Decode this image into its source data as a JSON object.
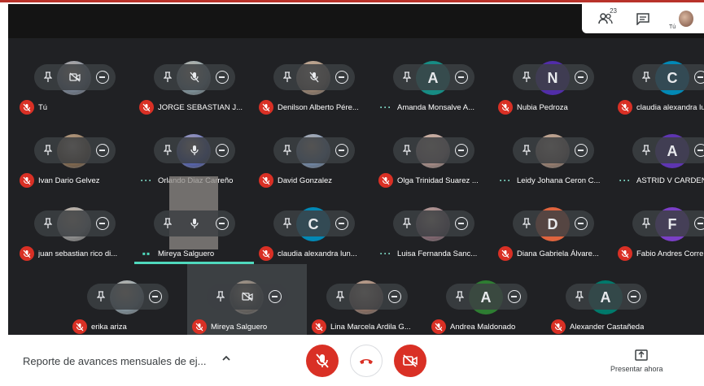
{
  "top_panel": {
    "people_count": "23",
    "you_label": "Tú"
  },
  "participants": [
    {
      "name": "Tú",
      "avatar_initial": "",
      "avatar_color": "#7f8b9d",
      "muted": true,
      "speaking": false,
      "center_icon": "camera-off-icon"
    },
    {
      "name": "JORGE SEBASTIAN J...",
      "avatar_initial": "",
      "avatar_color": "#8aa0a9",
      "muted": true,
      "speaking": false,
      "center_icon": "mic-off-icon"
    },
    {
      "name": "Denilson Alberto Pére...",
      "avatar_initial": "",
      "avatar_color": "#a58c78",
      "muted": true,
      "speaking": false,
      "center_icon": "mic-off-icon"
    },
    {
      "name": "Amanda Monsalve A...",
      "avatar_initial": "A",
      "avatar_color": "#178c84",
      "muted": false,
      "speaking": false,
      "center_icon": "avatar"
    },
    {
      "name": "Nubia Pedroza",
      "avatar_initial": "N",
      "avatar_color": "#512da8",
      "muted": true,
      "speaking": false,
      "center_icon": "avatar"
    },
    {
      "name": "claudia alexandra lu",
      "avatar_initial": "C",
      "avatar_color": "#0288b5",
      "muted": true,
      "speaking": false,
      "center_icon": "avatar"
    },
    {
      "name": "Ivan Dario Gelvez",
      "avatar_initial": "",
      "avatar_color": "#8b6f52",
      "muted": true,
      "speaking": false,
      "center_icon": "avatar"
    },
    {
      "name": "Orlando Diaz Carreño",
      "avatar_initial": "",
      "avatar_color": "#5c6bc0",
      "muted": false,
      "speaking": false,
      "center_icon": "mic-icon"
    },
    {
      "name": "David Gonzalez",
      "avatar_initial": "",
      "avatar_color": "#7a93b5",
      "muted": true,
      "speaking": false,
      "center_icon": "avatar"
    },
    {
      "name": "Olga Trinidad Suarez ...",
      "avatar_initial": "",
      "avatar_color": "#b89a94",
      "muted": true,
      "speaking": false,
      "center_icon": "avatar"
    },
    {
      "name": "Leidy Johana Ceron C...",
      "avatar_initial": "",
      "avatar_color": "#a78a79",
      "muted": false,
      "speaking": false,
      "center_icon": "avatar"
    },
    {
      "name": "ASTRID V CARDENA",
      "avatar_initial": "A",
      "avatar_color": "#5e35b1",
      "muted": false,
      "speaking": false,
      "center_icon": "avatar"
    },
    {
      "name": "juan sebastian rico di...",
      "avatar_initial": "",
      "avatar_color": "#9e9e9e",
      "muted": true,
      "speaking": false,
      "center_icon": "avatar"
    },
    {
      "name": "Mireya Salguero",
      "avatar_initial": "",
      "avatar_color": "#8e8a86",
      "muted": false,
      "speaking": true,
      "center_icon": "mic-icon"
    },
    {
      "name": "claudia alexandra lun...",
      "avatar_initial": "C",
      "avatar_color": "#0288b5",
      "muted": true,
      "speaking": false,
      "center_icon": "avatar"
    },
    {
      "name": "Luisa Fernanda Sanc...",
      "avatar_initial": "",
      "avatar_color": "#8e6f7a",
      "muted": false,
      "speaking": false,
      "center_icon": "avatar"
    },
    {
      "name": "Diana Gabriela Álvare...",
      "avatar_initial": "D",
      "avatar_color": "#e0643e",
      "muted": true,
      "speaking": false,
      "center_icon": "avatar"
    },
    {
      "name": "Fabio Andres Corre",
      "avatar_initial": "F",
      "avatar_color": "#7b3fc7",
      "muted": true,
      "speaking": false,
      "center_icon": "avatar"
    },
    {
      "name": "erika ariza",
      "avatar_initial": "",
      "avatar_color": "#8ea0aa",
      "muted": true,
      "speaking": false,
      "center_icon": "avatar"
    },
    {
      "name": "Mireya Salguero",
      "avatar_initial": "",
      "avatar_color": "#6e6a66",
      "muted": true,
      "speaking": false,
      "center_icon": "camera-off-icon",
      "active_tile": true
    },
    {
      "name": "Lina Marcela Ardila G...",
      "avatar_initial": "",
      "avatar_color": "#9a7b6d",
      "muted": true,
      "speaking": false,
      "center_icon": "avatar"
    },
    {
      "name": "Andrea Maldonado",
      "avatar_initial": "A",
      "avatar_color": "#2e7d32",
      "muted": true,
      "speaking": false,
      "center_icon": "avatar"
    },
    {
      "name": "Alexander Castañeda",
      "avatar_initial": "A",
      "avatar_color": "#00796b",
      "muted": true,
      "speaking": false,
      "center_icon": "avatar"
    }
  ],
  "bottom_bar": {
    "meeting_title": "Reporte de avances mensuales de ej...",
    "present_label": "Presentar ahora"
  },
  "colors": {
    "stage": "#202124",
    "muted_red": "#d93025",
    "speaking_teal": "#4fd9bd"
  }
}
